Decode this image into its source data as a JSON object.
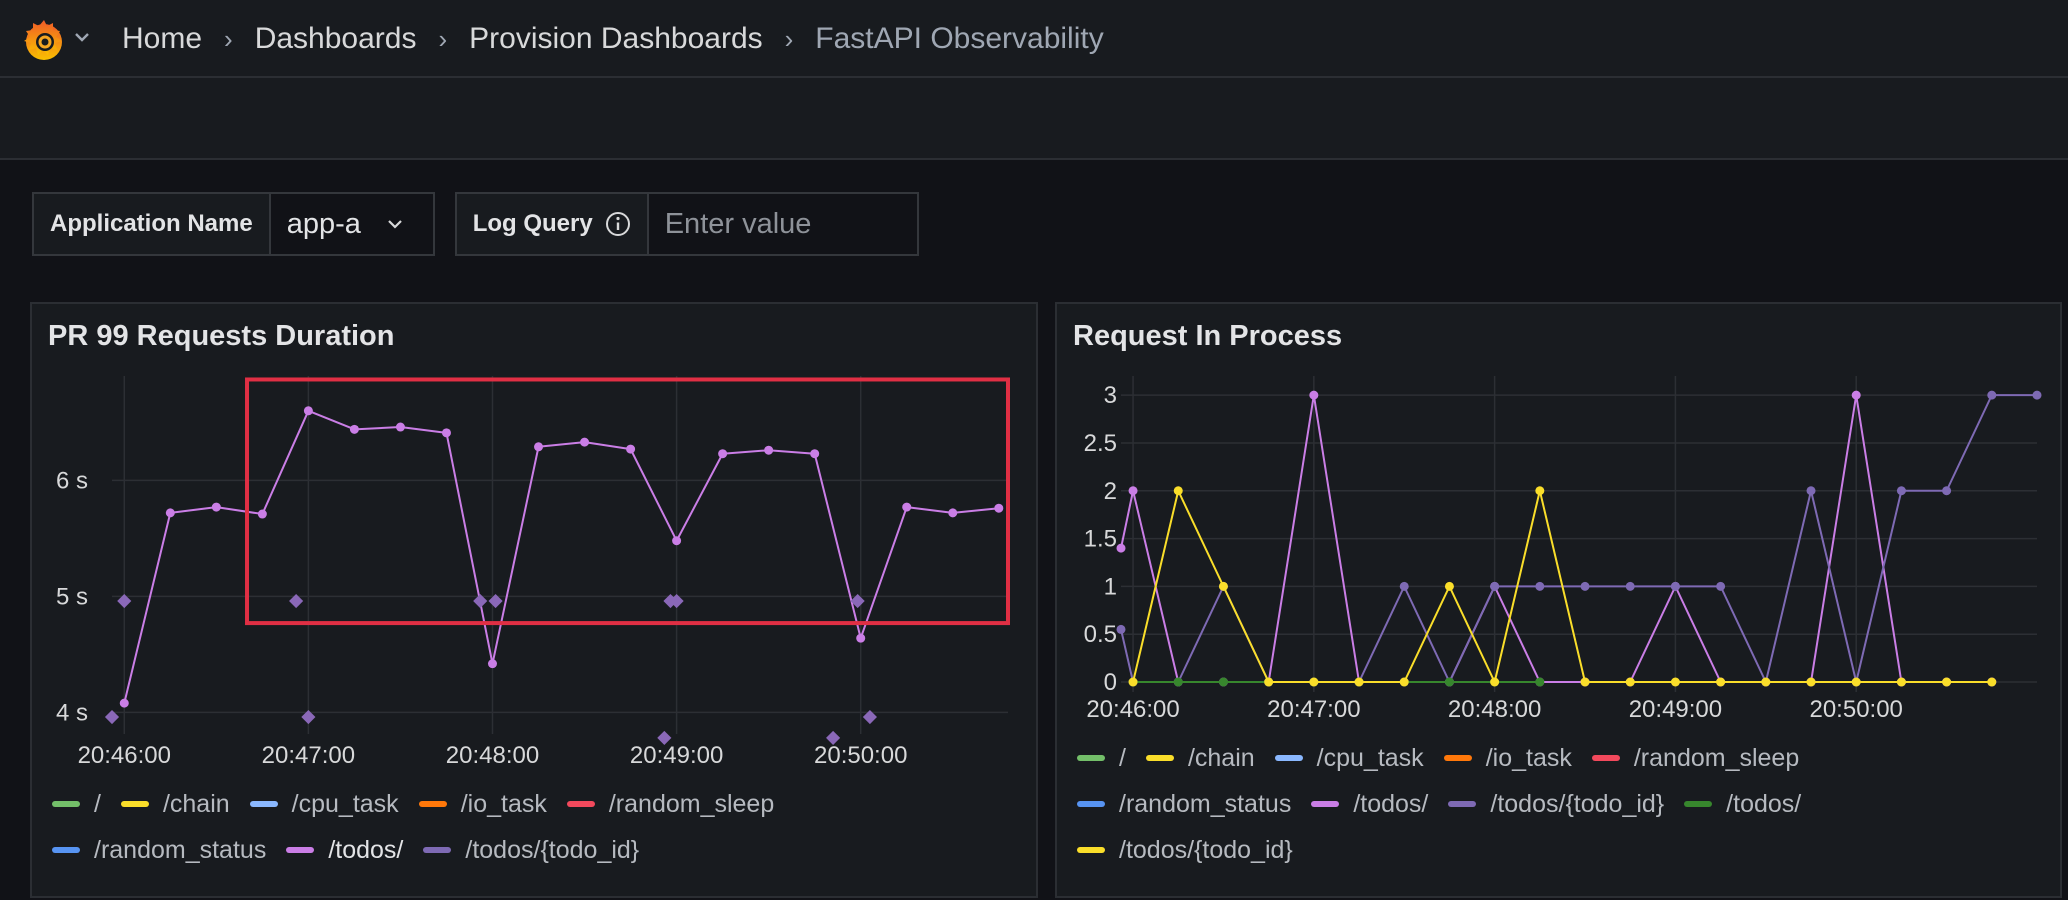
{
  "header": {
    "breadcrumbs": [
      "Home",
      "Dashboards",
      "Provision Dashboards",
      "FastAPI Observability"
    ]
  },
  "variables": {
    "app_label": "Application Name",
    "app_value": "app-a",
    "log_label": "Log Query",
    "log_placeholder": "Enter value"
  },
  "highlight_color": "#e02f44",
  "panels": [
    {
      "title": "PR 99 Requests Duration",
      "chart_data": {
        "type": "line",
        "x_ticks": [
          "20:46:00",
          "20:47:00",
          "20:48:00",
          "20:49:00",
          "20:50:00"
        ],
        "y_ticks": [
          "4 s",
          "5 s",
          "6 s"
        ],
        "ylim": [
          3.9,
          6.9
        ],
        "xlim": [
          "20:45:56",
          "20:50:48"
        ],
        "series": [
          {
            "name": "/todos/",
            "color": "#ca7ee6",
            "kind": "line",
            "x": [
              "20:46:00",
              "20:46:15",
              "20:46:30",
              "20:46:45",
              "20:47:00",
              "20:47:15",
              "20:47:30",
              "20:47:45",
              "20:48:00",
              "20:48:15",
              "20:48:30",
              "20:48:45",
              "20:49:00",
              "20:49:15",
              "20:49:30",
              "20:49:45",
              "20:50:00",
              "20:50:15",
              "20:50:30",
              "20:50:45"
            ],
            "values": [
              4.08,
              5.72,
              5.77,
              5.71,
              6.6,
              6.44,
              6.46,
              6.41,
              4.42,
              6.29,
              6.33,
              6.27,
              5.48,
              6.23,
              6.26,
              6.23,
              4.64,
              5.77,
              5.72,
              5.76
            ]
          },
          {
            "name": "/todos/{todo_id}",
            "color": "#8a68b8",
            "kind": "points",
            "x": [
              "20:45:56",
              "20:46:00",
              "20:46:56",
              "20:47:00",
              "20:47:56",
              "20:48:01",
              "20:48:56",
              "20:48:58",
              "20:49:00",
              "20:49:51",
              "20:49:59",
              "20:50:03"
            ],
            "values": [
              3.96,
              4.96,
              4.96,
              3.96,
              4.96,
              4.96,
              3.78,
              4.96,
              4.96,
              3.78,
              4.96,
              3.96
            ]
          }
        ],
        "legend": [
          "/",
          "/chain",
          "/cpu_task",
          "/io_task",
          "/random_sleep",
          "/random_status",
          "/todos/",
          "/todos/{todo_id}"
        ],
        "legend_colors": [
          "#73bf69",
          "#fade2a",
          "#8ab8ff",
          "#ff780a",
          "#f2495c",
          "#5794f2",
          "#ca7ee6",
          "#7e6ab4"
        ],
        "legend_active": [
          false,
          false,
          false,
          false,
          false,
          false,
          true,
          false
        ],
        "highlight_box": {
          "x": [
            "20:46:40",
            "20:50:48"
          ],
          "y": [
            4.77,
            6.87
          ]
        }
      }
    },
    {
      "title": "Request In Process",
      "chart_data": {
        "type": "line",
        "x_ticks": [
          "20:46:00",
          "20:47:00",
          "20:48:00",
          "20:49:00",
          "20:50:00"
        ],
        "y_ticks": [
          "0",
          "0.5",
          "1",
          "1.5",
          "2",
          "2.5",
          "3"
        ],
        "ylim": [
          0,
          3.2
        ],
        "xlim": [
          "20:45:56",
          "20:51:00"
        ],
        "series": [
          {
            "name": "/todos/",
            "color": "#ca7ee6",
            "x": [
              "20:45:56",
              "20:46:00",
              "20:46:15",
              "20:46:30",
              "20:46:45",
              "20:47:00",
              "20:47:15",
              "20:47:30",
              "20:47:45",
              "20:48:00",
              "20:48:15",
              "20:48:30",
              "20:48:45",
              "20:49:00",
              "20:49:15",
              "20:49:30",
              "20:49:45",
              "20:50:00",
              "20:50:15",
              "20:50:30",
              "20:50:45"
            ],
            "values": [
              1.4,
              2,
              0,
              0,
              0,
              3,
              0,
              0,
              0,
              1,
              0,
              0,
              0,
              1,
              0,
              0,
              0,
              3,
              0,
              0,
              0
            ]
          },
          {
            "name": "/todos/{todo_id}",
            "color": "#7e6ab4",
            "x": [
              "20:45:56",
              "20:46:00",
              "20:46:15",
              "20:46:30",
              "20:46:45",
              "20:47:00",
              "20:47:15",
              "20:47:30",
              "20:47:45",
              "20:48:00",
              "20:48:15",
              "20:48:30",
              "20:48:45",
              "20:49:00",
              "20:49:15",
              "20:49:30",
              "20:49:45",
              "20:50:00",
              "20:50:15",
              "20:50:30",
              "20:50:45",
              "20:51:00"
            ],
            "values": [
              0.55,
              0,
              0,
              1,
              0,
              0,
              0,
              1,
              0,
              1,
              1,
              1,
              1,
              1,
              1,
              0,
              2,
              0,
              2,
              2,
              3,
              3
            ]
          },
          {
            "name": "/",
            "color": "#37872d",
            "x": [
              "20:46:00",
              "20:46:15",
              "20:46:30",
              "20:46:45",
              "20:47:00",
              "20:47:15",
              "20:47:30",
              "20:47:45",
              "20:48:00",
              "20:48:15"
            ],
            "values": [
              0,
              0,
              0,
              0,
              0,
              0,
              0,
              0,
              0,
              0
            ]
          },
          {
            "name": "/chain",
            "color": "#fade2a",
            "x": [
              "20:46:00",
              "20:46:15",
              "20:46:30",
              "20:46:45",
              "20:47:00",
              "20:47:15",
              "20:47:30",
              "20:47:45",
              "20:48:00",
              "20:48:15",
              "20:48:30",
              "20:48:45",
              "20:49:00",
              "20:49:15",
              "20:49:30",
              "20:49:45",
              "20:50:00",
              "20:50:15",
              "20:50:30",
              "20:50:45"
            ],
            "values": [
              0,
              2,
              1,
              0,
              0,
              0,
              0,
              1,
              0,
              2,
              0,
              0,
              0,
              0,
              0,
              0,
              0,
              0,
              0,
              0
            ]
          }
        ],
        "legend": [
          "/",
          "/chain",
          "/cpu_task",
          "/io_task",
          "/random_sleep",
          "/random_status",
          "/todos/",
          "/todos/{todo_id}",
          "/todos/",
          "/todos/{todo_id}"
        ],
        "legend_colors": [
          "#73bf69",
          "#fade2a",
          "#8ab8ff",
          "#ff780a",
          "#f2495c",
          "#5794f2",
          "#ca7ee6",
          "#7e6ab4",
          "#37872d",
          "#fade2a"
        ]
      }
    }
  ]
}
